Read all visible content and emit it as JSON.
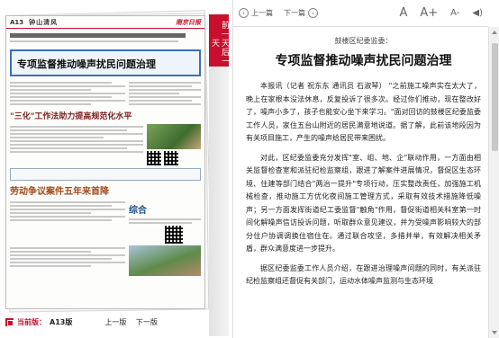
{
  "newspaper": {
    "page_no": "A13",
    "section": "钟山清风",
    "logo": "南京日报",
    "front_title": "专项监督推动噪声扰民问题治理",
    "sub_title": "\"三化\"工作法助力提高规范化水平",
    "lower_title": "劳动争议案件五年来首降",
    "column_label": "综合"
  },
  "edition_bar": {
    "current_label": "当前版：",
    "page": "A13版",
    "prev": "上一版",
    "next": "下一版"
  },
  "side_tab": {
    "text": "前一天后一天"
  },
  "toolbar": {
    "prev_label": "上一篇",
    "next_label": "下一篇",
    "font_large": "A",
    "font_plus": "A+",
    "font_minus": "A-",
    "speaker_icon": "speaker-icon"
  },
  "article": {
    "eyebrow": "鼓楼区纪委监委：",
    "headline": "专项监督推动噪声扰民问题治理",
    "paragraphs": [
      "本报讯（记者 祝东东 通讯员 石淑琴） \"之前施工噪声实在太大了，晚上在家根本没法休息，反复投诉了很多次。经过你们推动，现在整改好了，噪声小多了，孩子也能安心坐下来学习。\"面对回访的鼓楼区纪委监委工作人员，家住五台山附近的居民满意地说道。据了解，此前该地段因为有关项目施工，产生的噪声给居民带来困扰。",
      "对此，区纪委监委充分发挥\"室、组、地、企\"联动作用，一方面由相关监督检查室和派驻纪检监察组，跟进了解案件进展情况，督促区生态环境、住建等部门结合\"两治一提升\"专项行动，压实整改责任，加强施工机械检查，推动施工方优化夜间施工管理方式，采取有效技术措施降低噪声；另一方面发挥街道纪工委监督\"触角\"作用，督促街道相关科室第一时间化解噪声信访投诉问题，听取群众意见建议，并为受噪声影响较大的部分住户协调调换住宿住在。通过联合攻坚，多措并举，有效解决相关矛盾，群众满意度进一步提升。",
      "据区纪委监委工作人员介绍，在跟进治理噪声问题的同时，有关派驻纪检监察组还督促有关部门，运动水体噪声监测与生态环境"
    ]
  }
}
